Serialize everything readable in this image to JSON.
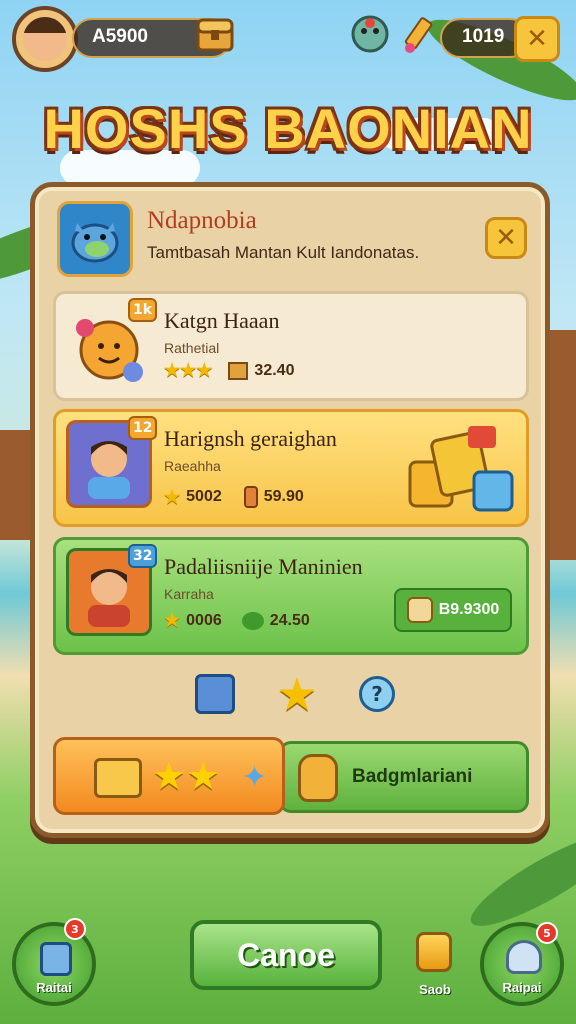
{
  "hud": {
    "coins": "A5900",
    "gems": "1019"
  },
  "title": "HOSHS BAONIAN",
  "panel": {
    "title": "Ndapnobia",
    "subtitle": "Tamtbasah Mantan Kult Iandonatas."
  },
  "cards": [
    {
      "title": "Katgn Haaan",
      "subtitle": "Rathetial",
      "badge": "1k",
      "stars": "★★★",
      "value": "32.40"
    },
    {
      "title": "Harignsh geraighan",
      "subtitle": "Raeahha",
      "badge": "12",
      "points": "5002",
      "value": "59.90"
    },
    {
      "title": "Padaliisniije Maninien",
      "subtitle": "Karraha",
      "badge": "32",
      "points": "0006",
      "value": "24.50",
      "price": "B9.9300"
    }
  ],
  "reward_bar": {
    "stars": "★★",
    "label": "Badgmlariani"
  },
  "bottom": {
    "main_button": "Canoe",
    "left_label": "Raitai",
    "left_notif": "3",
    "center_label": "Saob",
    "right_label": "Raipai",
    "right_notif": "5"
  },
  "colors": {
    "accent_green": "#58b13c",
    "accent_orange": "#f28a1f",
    "title_yellow": "#ffd24a",
    "panel_bg": "#e9d3a6"
  }
}
